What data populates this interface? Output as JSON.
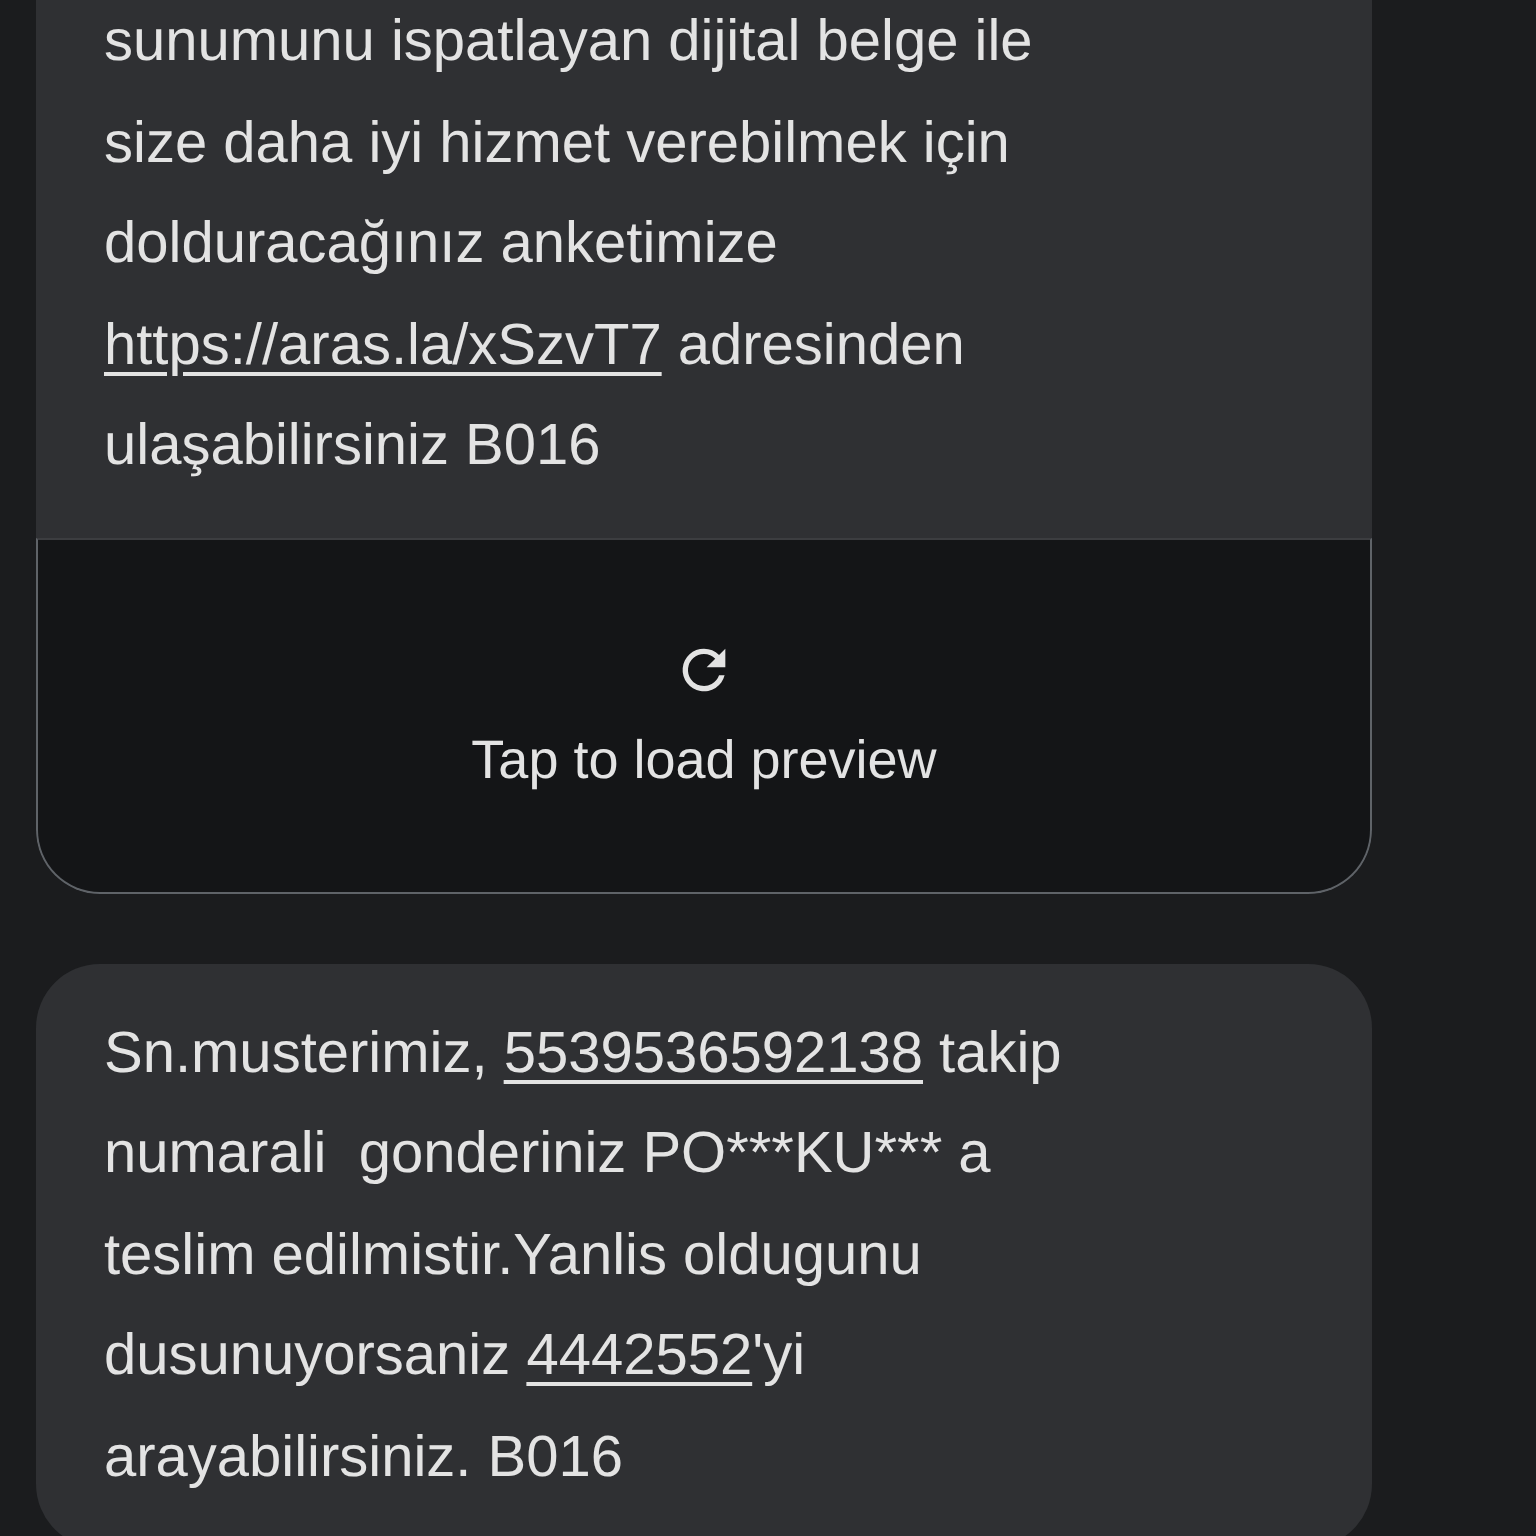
{
  "messages": [
    {
      "parts": [
        {
          "kind": "text",
          "text": "sunumunu ispatlayan dijital belge ile\nsize daha iyi hizmet verebilmek için\ndolduracağınız anketimize\n"
        },
        {
          "kind": "link",
          "text": "https://aras.la/xSzvT7"
        },
        {
          "kind": "text",
          "text": " adresinden\nulaşabilirsiniz B016"
        }
      ],
      "preview": {
        "label": "Tap to load preview"
      }
    },
    {
      "parts": [
        {
          "kind": "text",
          "text": "Sn.musterimiz, "
        },
        {
          "kind": "link",
          "text": "5539536592138"
        },
        {
          "kind": "text",
          "text": " takip\nnumarali  gonderiniz PO***KU*** a\nteslim edilmistir.Yanlis oldugunu\ndusunuyorsaniz "
        },
        {
          "kind": "link",
          "text": "4442552"
        },
        {
          "kind": "text",
          "text": "'yi\narayabilirsiniz. B016"
        }
      ]
    }
  ]
}
